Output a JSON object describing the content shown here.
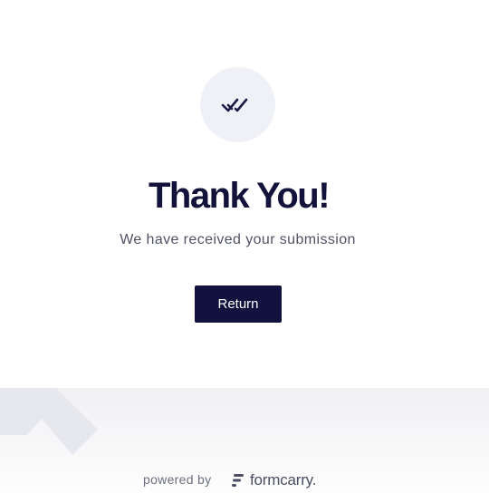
{
  "thank_you": {
    "title": "Thank You!",
    "message": "We have received your submission",
    "return_label": "Return"
  },
  "footer": {
    "powered_by": "powered by",
    "brand_name": "formcarry."
  },
  "colors": {
    "primary": "#12123f",
    "icon_bg": "#f0f1f6",
    "text_muted": "#505366"
  },
  "icons": {
    "success": "double-check-icon",
    "brand": "formcarry-logo-icon"
  }
}
